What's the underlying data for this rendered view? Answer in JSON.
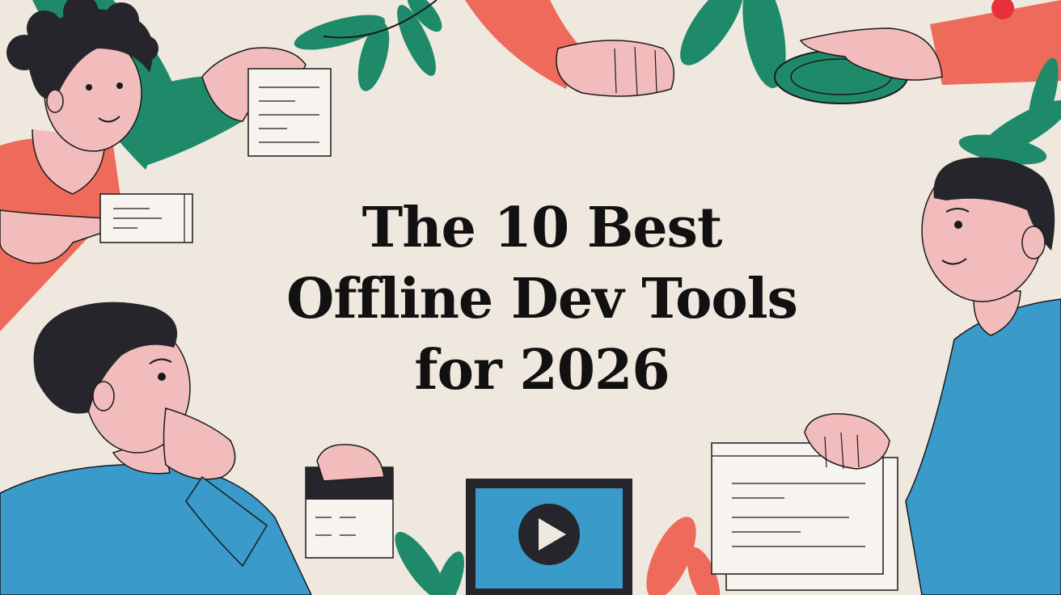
{
  "headline": {
    "line1": "The 10 Best",
    "line2": "Offline Dev Tools",
    "line3": "for 2026"
  },
  "colors": {
    "background": "#efe8df",
    "green": "#1f8a6a",
    "coral": "#ee6b5b",
    "blue": "#3a9ac9",
    "skin": "#f2bcbc",
    "hair": "#25252b",
    "ink": "#111111"
  },
  "icons": [
    "play-icon",
    "document-icon",
    "leaf-icon"
  ]
}
